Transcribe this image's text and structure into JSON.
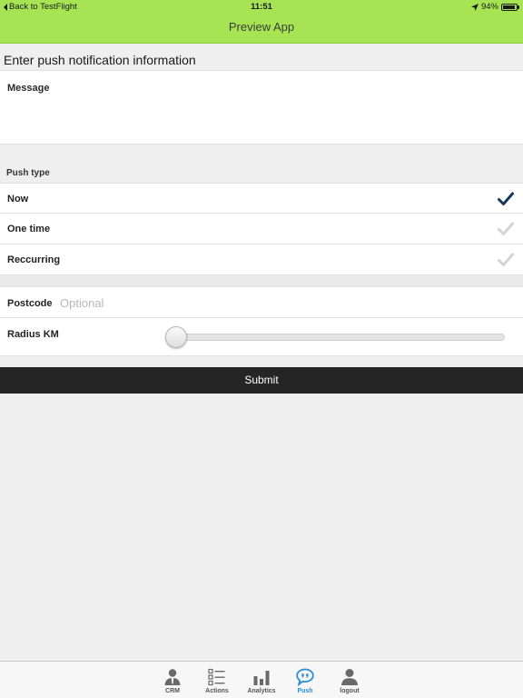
{
  "status_bar": {
    "back_label": "Back to TestFlight",
    "time": "11:51",
    "battery": "94%",
    "battery_level": 0.94
  },
  "nav": {
    "title": "Preview App"
  },
  "form": {
    "section_title": "Enter push notification information",
    "message_label": "Message",
    "push_type_label": "Push type",
    "push_types": [
      {
        "label": "Now",
        "selected": true
      },
      {
        "label": "One time",
        "selected": false
      },
      {
        "label": "Reccurring",
        "selected": false
      }
    ],
    "postcode_label": "Postcode",
    "postcode_placeholder": "Optional",
    "postcode_value": "",
    "radius_label": "Radius KM",
    "radius_value_fraction": 0,
    "submit_label": "Submit"
  },
  "tabs": [
    {
      "label": "CRM",
      "icon": "person-tie-icon",
      "active": false
    },
    {
      "label": "Actions",
      "icon": "checklist-icon",
      "active": false
    },
    {
      "label": "Analytics",
      "icon": "bar-chart-icon",
      "active": false
    },
    {
      "label": "Push",
      "icon": "speech-bubble-icon",
      "active": true
    },
    {
      "label": "logout",
      "icon": "person-icon",
      "active": false
    }
  ],
  "colors": {
    "header_bg": "#a6e454",
    "check_selected": "#17375e",
    "check_unselected": "#d4d4d4",
    "tab_active": "#2a8dd6",
    "submit_bg": "#252525"
  }
}
